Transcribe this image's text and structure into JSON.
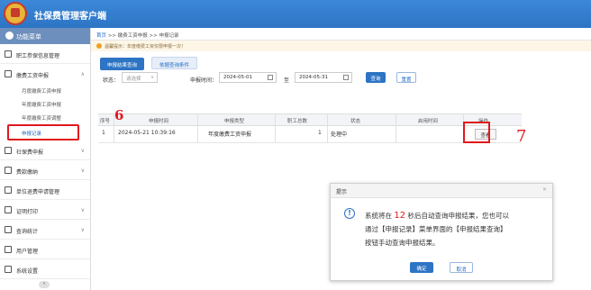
{
  "app": {
    "title": "社保费管理客户端"
  },
  "sidebar": {
    "header": "功能菜单",
    "items": [
      {
        "label": "职工参保信息管理",
        "icon": "user-list-icon",
        "expandable": false
      },
      {
        "label": "缴费工资申报",
        "icon": "edit-icon",
        "expandable": true,
        "expanded": true,
        "children": [
          {
            "label": "月度缴费工资申报"
          },
          {
            "label": "年度缴费工资申报"
          },
          {
            "label": "年度缴费工资调整"
          },
          {
            "label": "申报记录",
            "active": true
          }
        ]
      },
      {
        "label": "社保费申报",
        "icon": "doc-icon",
        "expandable": true
      },
      {
        "label": "费款缴纳",
        "icon": "money-icon",
        "expandable": true
      },
      {
        "label": "单位退费申请管理",
        "icon": "refund-icon",
        "expandable": false
      },
      {
        "label": "证明打印",
        "icon": "print-icon",
        "expandable": true
      },
      {
        "label": "查询统计",
        "icon": "chart-icon",
        "expandable": true
      },
      {
        "label": "用户管理",
        "icon": "user-icon",
        "expandable": false
      },
      {
        "label": "系统设置",
        "icon": "gear-icon",
        "expandable": false
      }
    ],
    "collapse": "«"
  },
  "breadcrumb": {
    "home": "首页",
    "sep1": ">>",
    "level1": "缴费工资申报",
    "sep2": ">>",
    "level2": "申报记录"
  },
  "notice": "温馨提示：年度缴费工资仅限申报一次！",
  "tabs": [
    {
      "label": "申报结果查询",
      "active": true
    },
    {
      "label": "依据查询条件",
      "active": false
    }
  ],
  "filters": {
    "status_label": "状态：",
    "status_placeholder": "请选择",
    "time_label": "申报时间：",
    "date_from": "2024-05-01",
    "to_label": "至",
    "date_to": "2024-05-31",
    "query_btn": "查询",
    "reset_btn": "重置"
  },
  "table": {
    "columns": [
      "序号",
      "申报时间",
      "申报类型",
      "职工总数",
      "状态",
      "启用时间",
      "操作"
    ],
    "rows": [
      {
        "index": "1",
        "time": "2024-05-21 10:39:16",
        "type": "年度缴费工资申报",
        "count": "1",
        "status": "处理中",
        "enable_time": "",
        "action": "查看"
      }
    ]
  },
  "annotations": {
    "a6": "6",
    "a7": "7",
    "color": "#e0191e"
  },
  "dialog": {
    "title": "提示",
    "close": "×",
    "icon": "!",
    "line1_pre": "系统将在 ",
    "seconds": "12",
    "line1_post": " 秒后自动查询申报结果，您也可以",
    "line2": "通过【申报记录】菜单界面的【申报结果查询】",
    "line3": "按钮手动查询申报结果。",
    "ok": "确定",
    "cancel": "取消"
  },
  "colors": {
    "brand": "#2d74c4",
    "alert": "#e0191e"
  }
}
